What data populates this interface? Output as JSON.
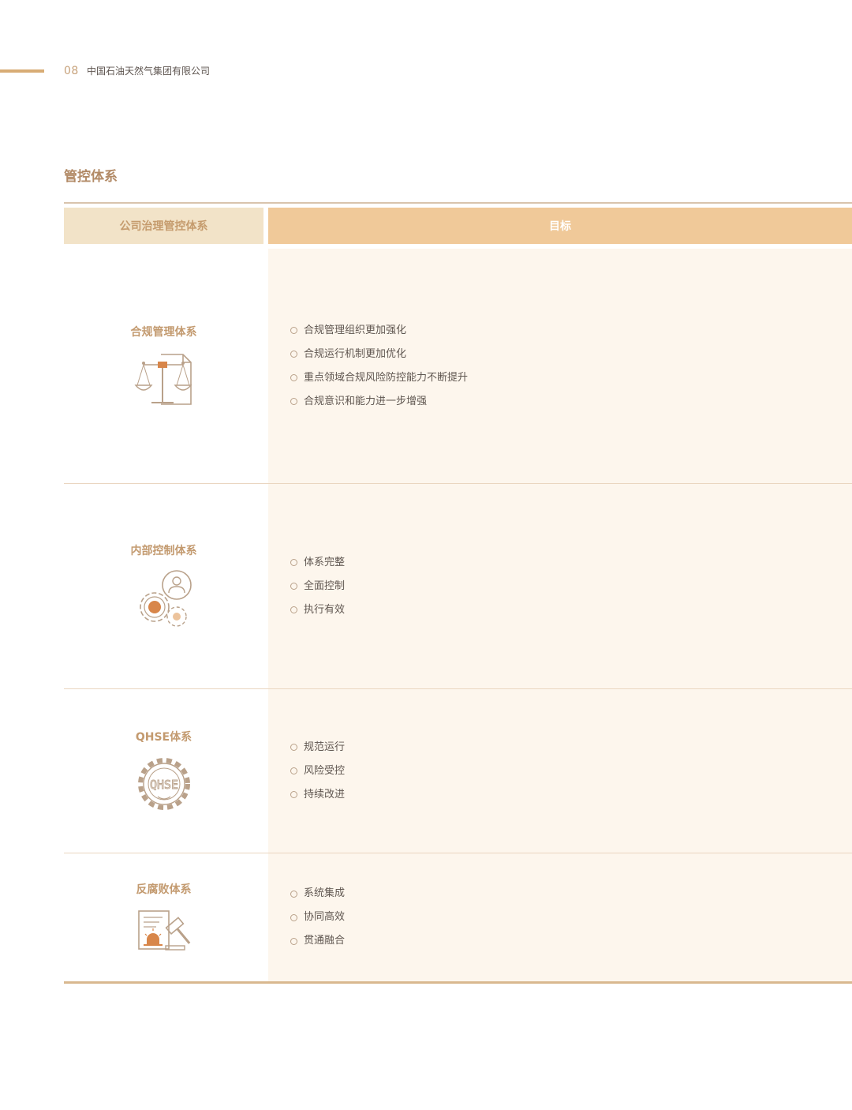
{
  "header": {
    "page_number": "08",
    "company": "中国石油天然气集团有限公司"
  },
  "section": {
    "title": "管控体系"
  },
  "table": {
    "headers": [
      "公司治理管控体系",
      "目标"
    ],
    "rows": [
      {
        "name": "合规管理体系",
        "icon": "scales-document-icon",
        "goals": [
          "合规管理组织更加强化",
          "合规运行机制更加优化",
          "重点领域合规风险防控能力不断提升",
          "合规意识和能力进一步增强"
        ]
      },
      {
        "name": "内部控制体系",
        "icon": "gears-person-icon",
        "goals": [
          "体系完整",
          "全面控制",
          "执行有效"
        ]
      },
      {
        "name": "QHSE体系",
        "icon": "qhse-gear-icon",
        "icon_text": "QHSE",
        "goals": [
          "规范运行",
          "风险受控",
          "持续改进"
        ]
      },
      {
        "name": "反腐败体系",
        "icon": "gavel-document-alarm-icon",
        "goals": [
          "系统集成",
          "协同高效",
          "贯通融合"
        ]
      }
    ]
  },
  "colors": {
    "accent": "#d8ac75",
    "header_left_bg": "#f2e3c8",
    "header_right_bg": "#f0c999",
    "goal_bg": "#fdf6ed",
    "title_text": "#c39a6f",
    "icon_dot": "#d8864a"
  }
}
